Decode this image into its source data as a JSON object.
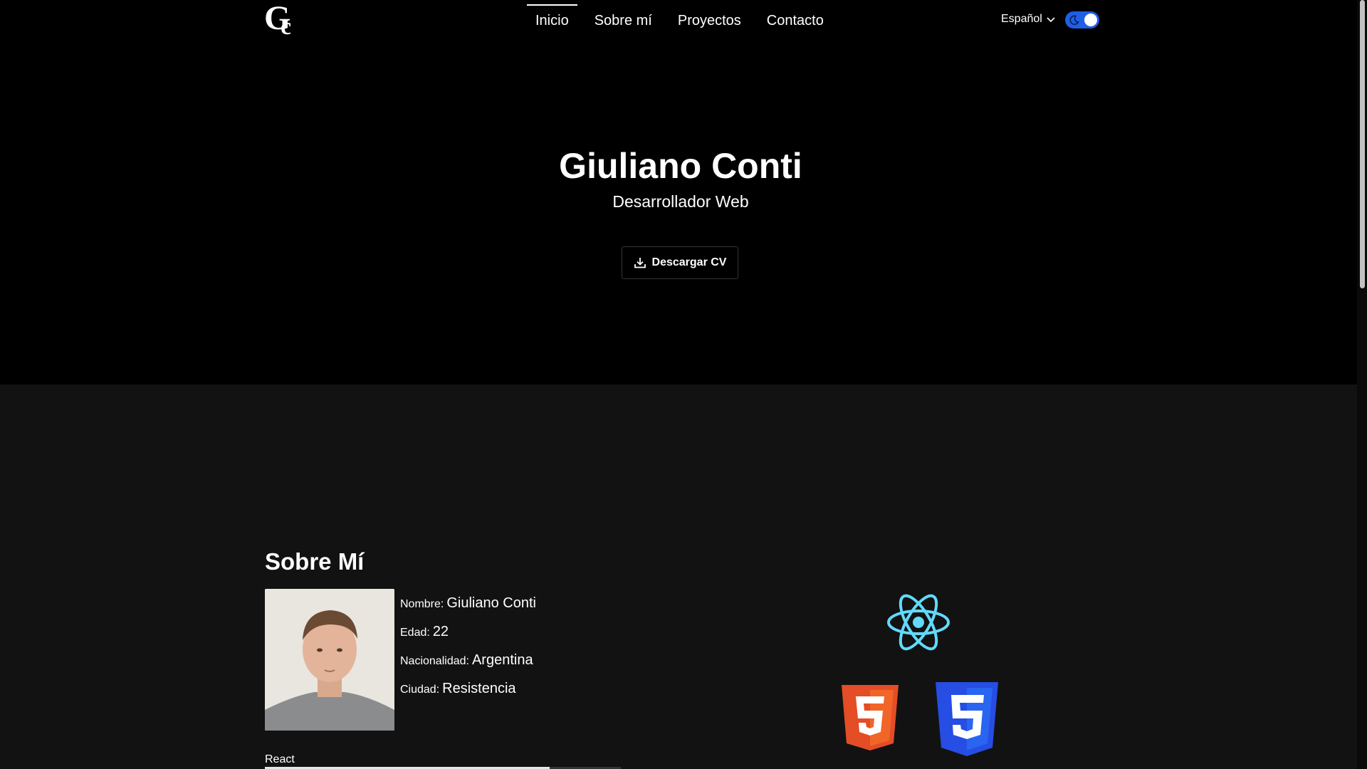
{
  "logo": {
    "letters": "Gc",
    "g": "G",
    "c": "c"
  },
  "nav": {
    "items": [
      {
        "label": "Inicio",
        "active": true
      },
      {
        "label": "Sobre mí",
        "active": false
      },
      {
        "label": "Proyectos",
        "active": false
      },
      {
        "label": "Contacto",
        "active": false
      }
    ]
  },
  "language": {
    "selected": "Español",
    "icon": "chevron-down-icon"
  },
  "theme_toggle": {
    "state": "dark",
    "icon": "moon-icon",
    "accent": "#1f5ee6"
  },
  "hero": {
    "name": "Giuliano Conti",
    "role": "Desarrollador Web",
    "cv_button": "Descargar CV",
    "cv_icon": "download-icon"
  },
  "about": {
    "title": "Sobre Mí",
    "fields": [
      {
        "key": "Nombre:",
        "value": "Giuliano Conti"
      },
      {
        "key": "Edad:",
        "value": "22"
      },
      {
        "key": "Nacionalidad:",
        "value": "Argentina"
      },
      {
        "key": "Ciudad:",
        "value": "Resistencia"
      }
    ],
    "skills": [
      {
        "label": "React",
        "level": 0.8
      }
    ]
  },
  "tech_icons": [
    "react-logo-icon",
    "html5-logo-icon",
    "css3-logo-icon"
  ],
  "colors": {
    "background_top": "#000000",
    "background_bottom": "#121212",
    "react": "#61dafb",
    "html5": "#e44d26",
    "css3": "#264de4"
  }
}
